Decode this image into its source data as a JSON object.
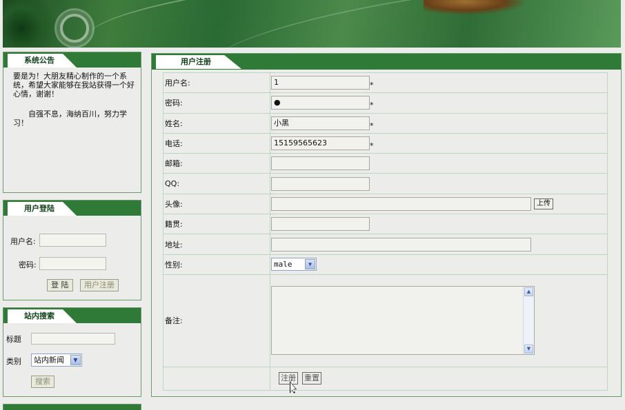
{
  "notice": {
    "title": "系统公告",
    "line1": "要是为！大朋友精心制作的一个系统，希望大家能够在我站获得一个好心情，谢谢！",
    "line2": "自强不息，海纳百川，努力学习！"
  },
  "login": {
    "title": "用户登陆",
    "username_label": "用户名:",
    "username_value": "",
    "password_label": "密码:",
    "password_value": "",
    "login_button": "登 陆",
    "register_button": "用户注册"
  },
  "search": {
    "title": "站内搜索",
    "title_label": "标题",
    "title_value": "",
    "category_label": "类别",
    "category_value": "站内新闻",
    "search_button": "搜索"
  },
  "register": {
    "title": "用户注册",
    "fields": {
      "username": {
        "label": "用户名:",
        "value": "1",
        "required_mark": "*"
      },
      "password": {
        "label": "密码:",
        "value": "●",
        "required_mark": "*"
      },
      "name": {
        "label": "姓名:",
        "value": "小黑",
        "required_mark": "*"
      },
      "phone": {
        "label": "电话:",
        "value": "15159565623",
        "required_mark": "*"
      },
      "email": {
        "label": "邮箱:",
        "value": ""
      },
      "qq": {
        "label": "QQ:",
        "value": ""
      },
      "avatar": {
        "label": "头像:",
        "value": "",
        "upload_button": "上传"
      },
      "native_place": {
        "label": "籍贯:",
        "value": ""
      },
      "address": {
        "label": "地址:",
        "value": ""
      },
      "gender": {
        "label": "性别:",
        "value": "male"
      },
      "remarks": {
        "label": "备注:",
        "value": ""
      }
    },
    "submit_button": "注册",
    "reset_button": "重置"
  }
}
